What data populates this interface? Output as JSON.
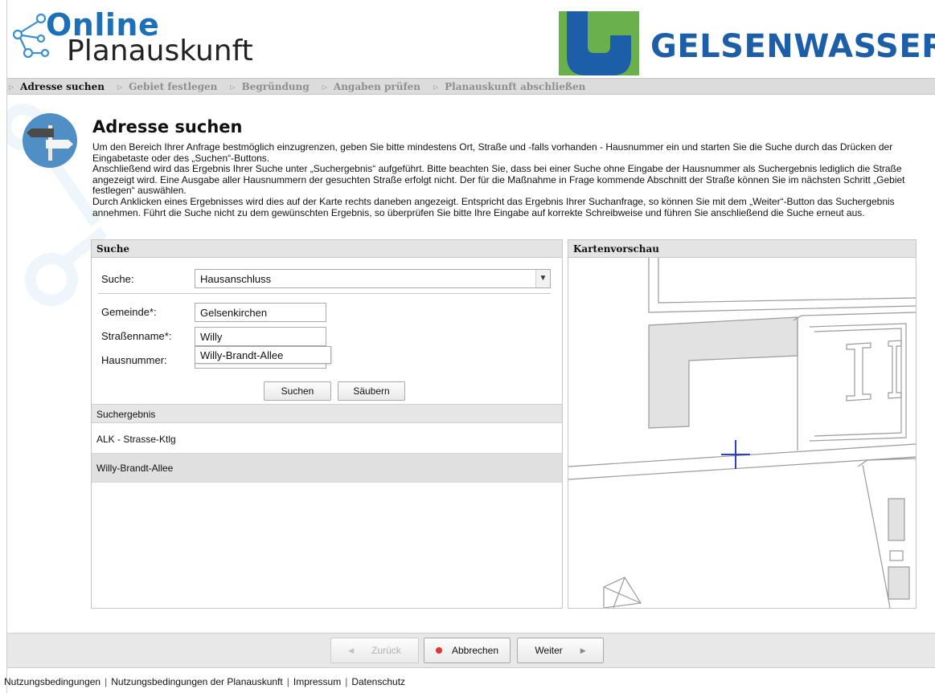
{
  "header": {
    "logo_line1": "Online",
    "logo_line2": "Planauskunft",
    "brand": "GELSENWASSER"
  },
  "breadcrumb": [
    {
      "label": "Adresse suchen",
      "active": true
    },
    {
      "label": "Gebiet festlegen",
      "active": false
    },
    {
      "label": "Begründung",
      "active": false
    },
    {
      "label": "Angaben prüfen",
      "active": false
    },
    {
      "label": "Planauskunft abschließen",
      "active": false
    }
  ],
  "page": {
    "title": "Adresse suchen",
    "intro": [
      "Um den Bereich Ihrer Anfrage bestmöglich einzugrenzen, geben Sie bitte mindestens Ort, Straße und -falls vorhanden - Hausnummer ein und starten Sie die Suche durch das Drücken der Eingabetaste oder des „Suchen“-Buttons.",
      "Anschließend wird das Ergebnis Ihrer Suche unter „Suchergebnis“ aufgeführt. Bitte beachten Sie, dass bei einer Suche ohne Eingabe der Hausnummer als Suchergebnis lediglich die Straße angezeigt wird. Eine Ausgabe aller Hausnummern der gesuchten Straße erfolgt nicht. Der für die Maßnahme in Frage kommende Abschnitt der Straße können Sie im nächsten Schritt „Gebiet festlegen“ auswählen.",
      "Durch Anklicken eines Ergebnisses wird dies auf der Karte rechts daneben angezeigt. Entspricht das Ergebnis Ihrer Suchanfrage, so können Sie mit dem „Weiter“-Button das Suchergebnis annehmen. Führt die Suche nicht zu dem gewünschten Ergebnis, so überprüfen Sie bitte Ihre Eingabe auf korrekte Schreibweise und führen Sie anschließend die Suche erneut aus."
    ]
  },
  "search": {
    "panel_title": "Suche",
    "type_label": "Suche:",
    "type_value": "Hausanschluss",
    "gemeinde_label": "Gemeinde*:",
    "gemeinde_value": "Gelsenkirchen",
    "strasse_label": "Straßenname*:",
    "strasse_value": "Willy",
    "autocomplete_option": "Willy-Brandt-Allee",
    "hausnummer_label": "Hausnummer:",
    "hausnummer_value": "",
    "search_button": "Suchen",
    "clear_button": "Säubern",
    "results_title": "Suchergebnis",
    "results": [
      {
        "label": "ALK - Strasse-Ktlg",
        "selected": false
      },
      {
        "label": "Willy-Brandt-Allee",
        "selected": true
      }
    ]
  },
  "map": {
    "panel_title": "Kartenvorschau",
    "marker_color": "#2d3ec9"
  },
  "footer": {
    "back_label": "Zurück",
    "cancel_label": "Abbrechen",
    "next_label": "Weiter",
    "links": [
      "Nutzungsbedingungen",
      "Nutzungsbedingungen der Planauskunft",
      "Impressum",
      "Datenschutz"
    ]
  },
  "colors": {
    "brand_blue": "#1d5ea8",
    "brand_green": "#6ab04c",
    "breadcrumb_bg": "#dcdcdc"
  }
}
